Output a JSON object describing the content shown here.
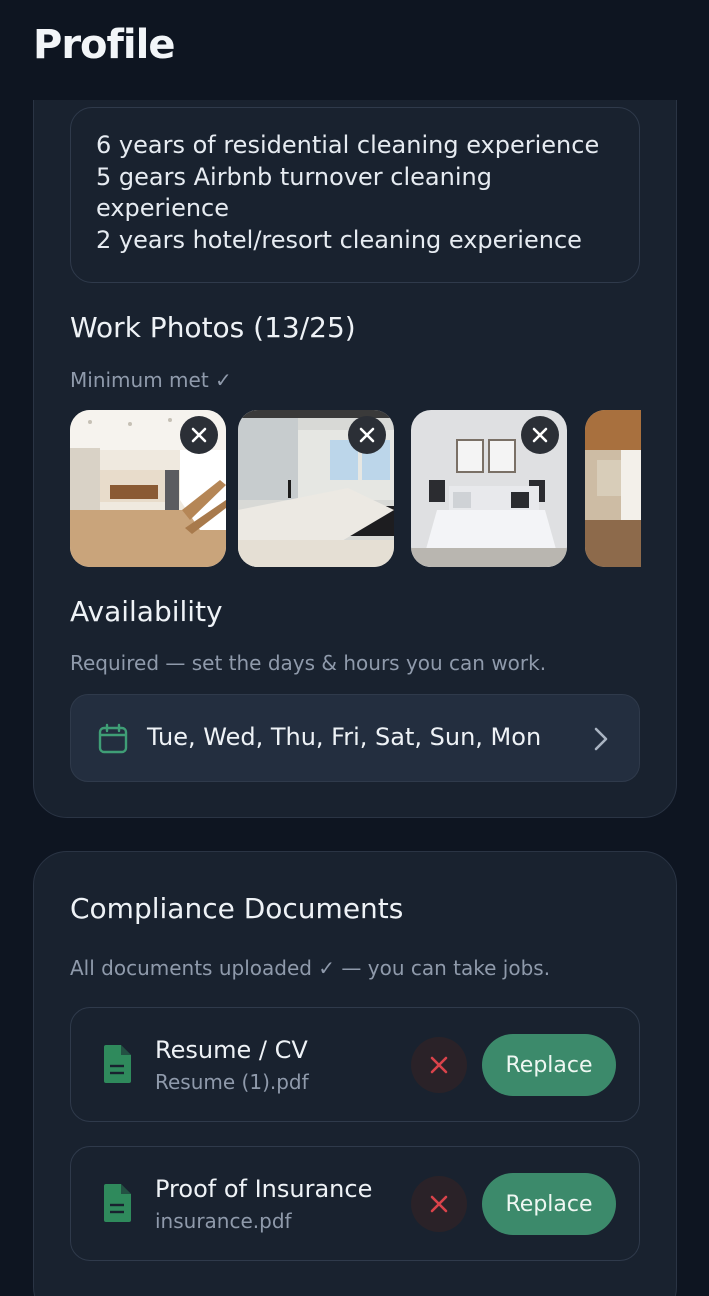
{
  "header": {
    "title": "Profile"
  },
  "experience": {
    "text": "6 years of residential cleaning experience\n5 gears Airbnb turnover cleaning experience\n2 years hotel/resort cleaning experience"
  },
  "work_photos": {
    "title": "Work Photos (13/25)",
    "status": "Minimum met ✓",
    "photos": [
      {
        "subject": "kitchen-and-stairs"
      },
      {
        "subject": "bathroom-vanity"
      },
      {
        "subject": "bedroom"
      },
      {
        "subject": "wood-ceiling-room"
      }
    ],
    "remove_icon": "close-icon"
  },
  "availability": {
    "title": "Availability",
    "subtitle": "Required — set the days & hours you can work.",
    "days": "Tue, Wed, Thu, Fri, Sat, Sun, Mon",
    "icon": "calendar-icon"
  },
  "compliance": {
    "title": "Compliance Documents",
    "subtitle": "All documents uploaded ✓ — you can take jobs.",
    "documents": [
      {
        "title": "Resume / CV",
        "file": "Resume (1).pdf",
        "replace_label": "Replace"
      },
      {
        "title": "Proof of Insurance",
        "file": "insurance.pdf",
        "replace_label": "Replace"
      }
    ]
  },
  "colors": {
    "background": "#0e1521",
    "card": "#19222f",
    "accent_green": "#3c8a6b",
    "icon_green": "#2f8a5c",
    "delete_red": "#d9434b"
  }
}
